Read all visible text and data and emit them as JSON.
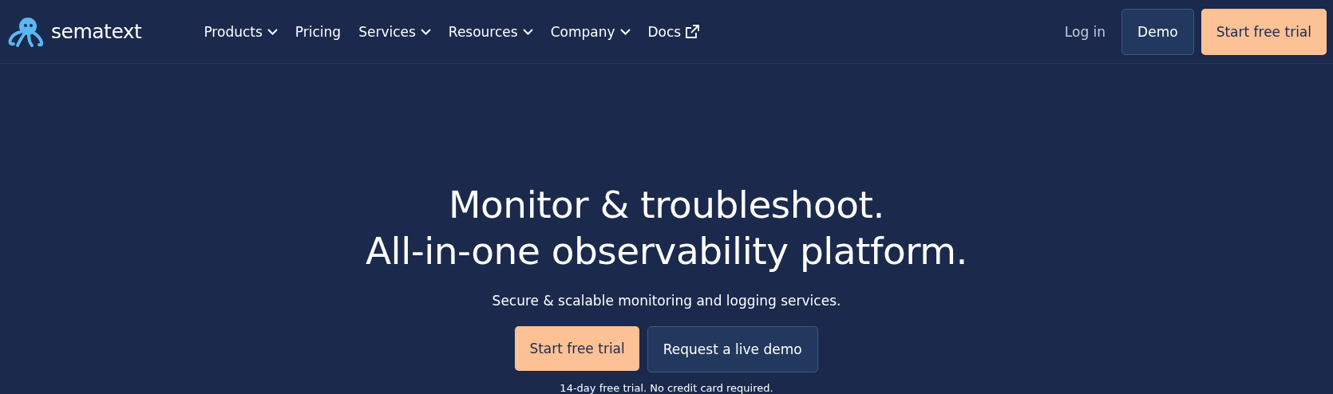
{
  "header": {
    "logo": "sematext",
    "nav": [
      {
        "label": "Products",
        "kind": "dropdown"
      },
      {
        "label": "Pricing",
        "kind": "link"
      },
      {
        "label": "Services",
        "kind": "dropdown"
      },
      {
        "label": "Resources",
        "kind": "dropdown"
      },
      {
        "label": "Company",
        "kind": "dropdown"
      },
      {
        "label": "Docs",
        "kind": "external"
      }
    ],
    "login": "Log in",
    "demo": "Demo",
    "trial": "Start free trial"
  },
  "hero": {
    "headline": [
      "Monitor & troubleshoot.",
      "All-in-one observability platform."
    ],
    "subtitle": "Secure & scalable monitoring and logging services.",
    "primary": "Start free trial",
    "secondary": "Request a live demo",
    "note": "14-day free trial. No credit card required."
  }
}
